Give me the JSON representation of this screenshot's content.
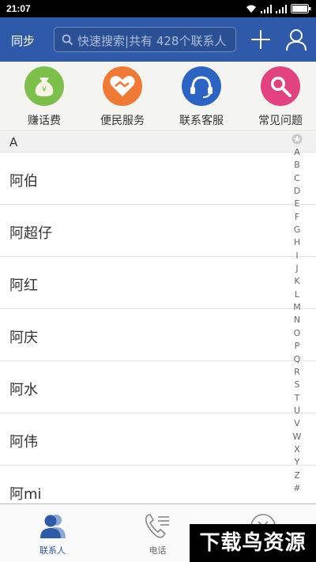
{
  "status_bar": {
    "time": "21:07",
    "icons": [
      "wifi-icon",
      "signal-icon",
      "signal-icon-2",
      "battery-icon"
    ]
  },
  "header": {
    "sync_label": "同步",
    "search_placeholder": "快速搜索|共有 428个联系人",
    "icons": [
      "search-icon",
      "add-icon",
      "user-icon"
    ],
    "bg_color": "#2f5aa9"
  },
  "quick_actions": [
    {
      "label": "赚话费",
      "icon": "money-bag-icon",
      "color": "#7cbf4a"
    },
    {
      "label": "便民服务",
      "icon": "handshake-icon",
      "color": "#f07a35"
    },
    {
      "label": "联系客服",
      "icon": "headset-icon",
      "color": "#2b64c2"
    },
    {
      "label": "常见问题",
      "icon": "magnifier-icon",
      "color": "#e2427f"
    }
  ],
  "contacts": {
    "section_letter": "A",
    "items": [
      "阿伯",
      "阿超仔",
      "阿红",
      "阿庆",
      "阿水",
      "阿伟",
      "阿mi"
    ]
  },
  "index_bar": {
    "letters": [
      "A",
      "B",
      "C",
      "D",
      "E",
      "F",
      "G",
      "H",
      "I",
      "J",
      "K",
      "L",
      "M",
      "N",
      "O",
      "P",
      "Q",
      "R",
      "S",
      "T",
      "U",
      "V",
      "W",
      "X",
      "Y",
      "Z",
      "#"
    ]
  },
  "bottom_nav": [
    {
      "label": "联系人",
      "icon": "contacts-icon",
      "active": true
    },
    {
      "label": "电话",
      "icon": "phone-icon",
      "active": false
    },
    {
      "label": "",
      "icon": "close-circle-icon",
      "active": false
    }
  ],
  "watermark": "下载鸟资源"
}
